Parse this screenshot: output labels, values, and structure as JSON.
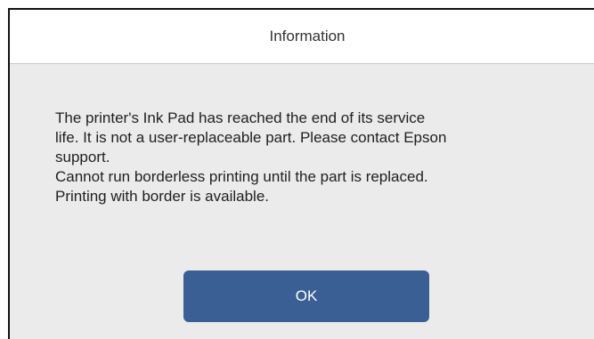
{
  "dialog": {
    "title": "Information",
    "message_lines": [
      "The printer's Ink Pad has reached the end of its service",
      "life. It is not a user-replaceable part. Please contact Epson",
      "support.",
      "Cannot run borderless printing until the part is replaced.",
      "Printing with border is available."
    ],
    "ok_label": "OK"
  },
  "colors": {
    "header_background": "#ffffff",
    "body_background": "#ebebeb",
    "button_background": "#3a5f95",
    "button_text": "#ffffff"
  }
}
